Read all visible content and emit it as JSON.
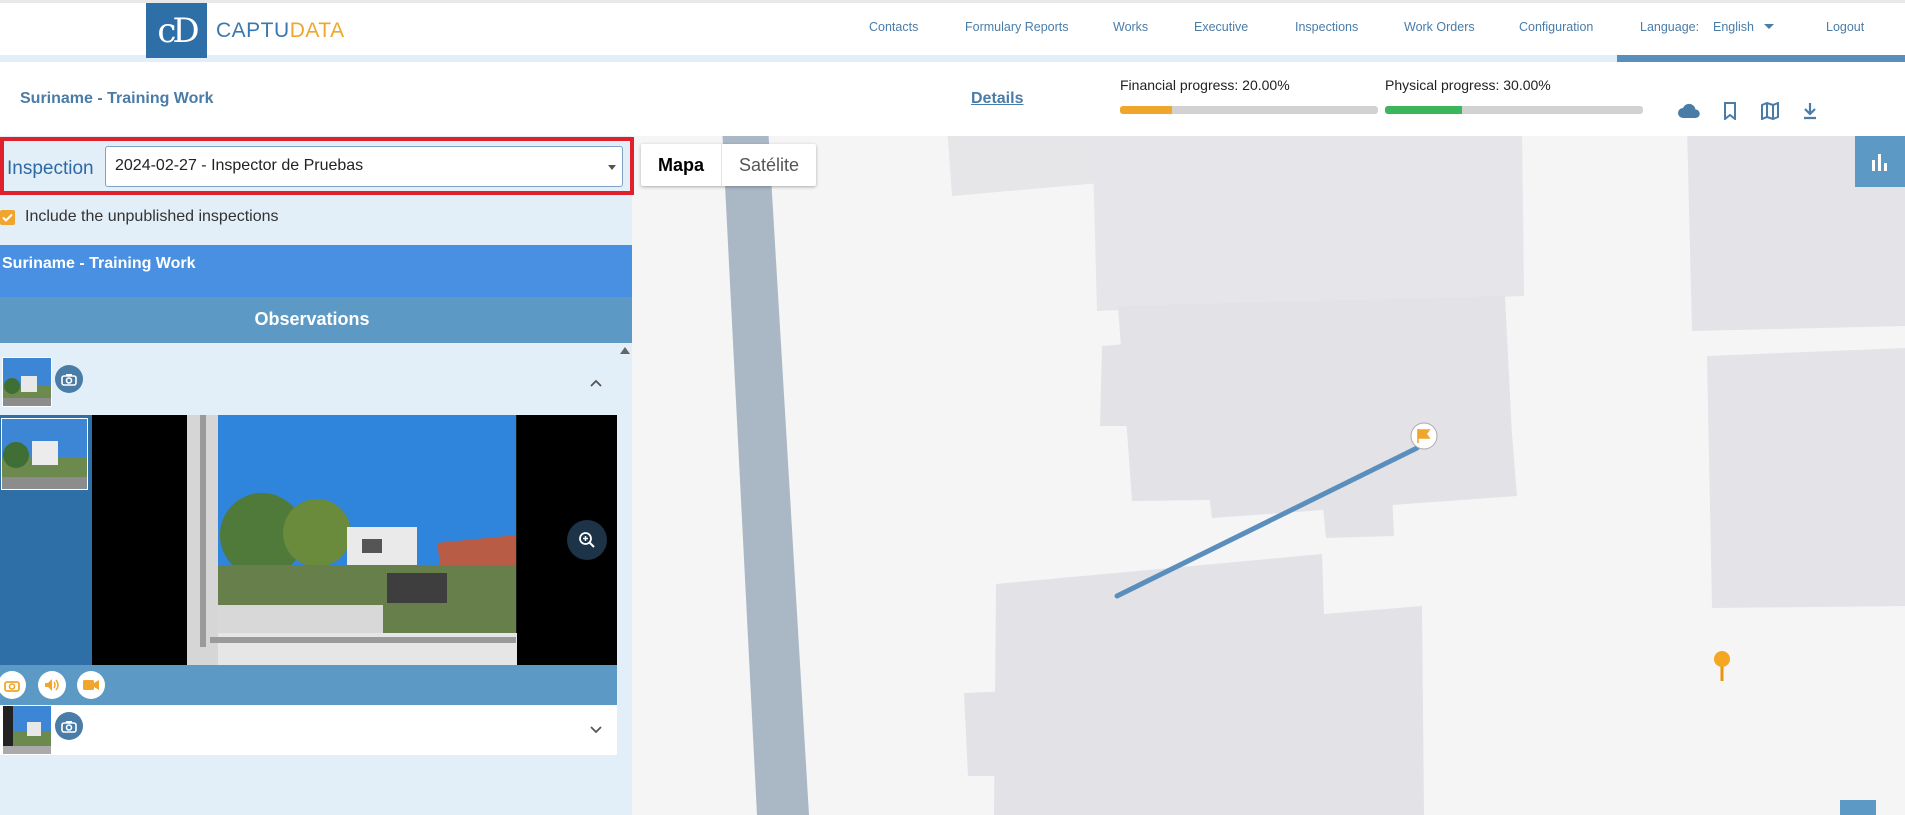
{
  "brand": {
    "logo_mark": "cD",
    "name_part1": "CAPTU",
    "name_part2": "DATA",
    "brand_blue": "#2f6fa8",
    "brand_orange": "#f0a62c"
  },
  "nav": {
    "items": [
      "Contacts",
      "Formulary Reports",
      "Works",
      "Executive",
      "Inspections",
      "Work Orders",
      "Configuration"
    ],
    "language_label": "Language:",
    "language_value": "English",
    "logout": "Logout"
  },
  "header": {
    "work_title": "Suriname - Training Work",
    "details_link": "Details",
    "financial_label": "Financial progress: 20.00%",
    "financial_value": 0.2,
    "financial_color": "#f0a62c",
    "physical_label": "Physical progress: 30.00%",
    "physical_value": 0.3,
    "physical_color": "#3cb65a",
    "toolbar_icons": [
      "cloud-icon",
      "bookmark-icon",
      "map-icon",
      "download-icon"
    ]
  },
  "inspection": {
    "label": "Inspection",
    "selected": "2024-02-27 - Inspector de Pruebas",
    "include_unpublished_label": "Include the unpublished inspections",
    "include_unpublished_checked": true
  },
  "panel": {
    "work_band": "Suriname - Training Work",
    "observations_title": "Observations"
  },
  "map": {
    "type_map": "Mapa",
    "type_satellite": "Satélite"
  }
}
